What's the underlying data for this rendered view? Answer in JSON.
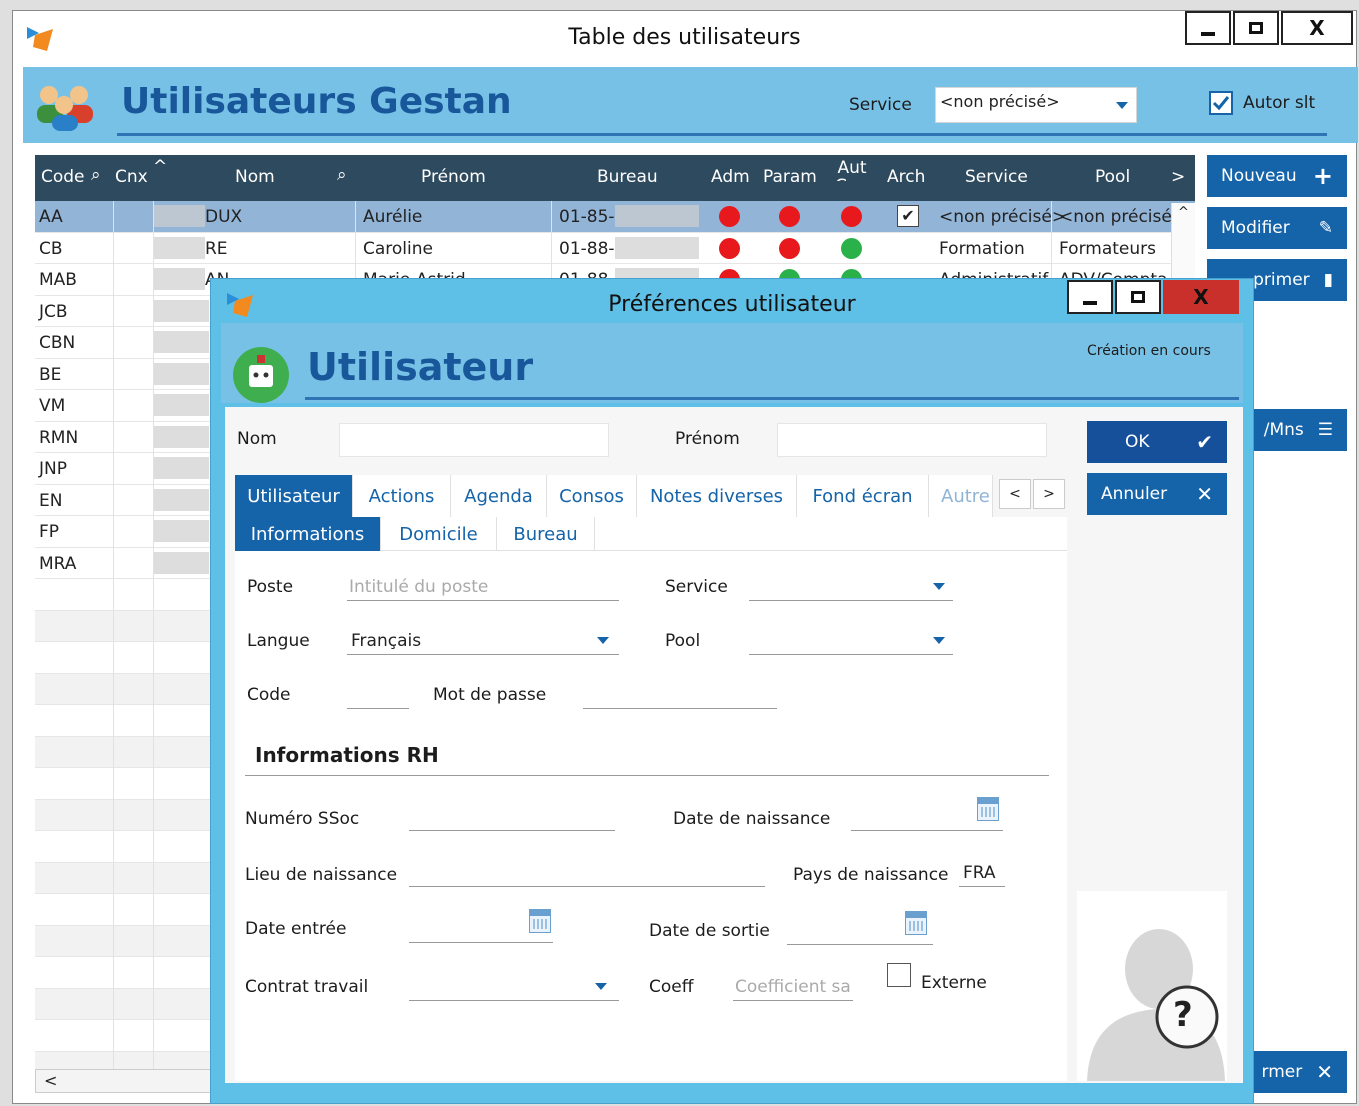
{
  "main_window": {
    "title": "Table des utilisateurs",
    "header_title": "Utilisateurs Gestan",
    "service_label": "Service",
    "service_value": "<non précisé>",
    "autor_label": "Autor slt"
  },
  "columns": [
    "Code",
    "Cnx",
    "Nom",
    "Prénom",
    "Bureau",
    "Adm",
    "Param",
    "Aut Conn",
    "Arch",
    "Service",
    "Pool"
  ],
  "rows": [
    {
      "code": "AA",
      "nom": "DUX",
      "prenom": "Aurélie",
      "bureau": "01-85-",
      "adm": "red",
      "param": "red",
      "aut": "red",
      "arch": true,
      "service": "<non précisé>",
      "pool": "<non précisé>"
    },
    {
      "code": "CB",
      "nom": "RE",
      "prenom": "Caroline",
      "bureau": "01-88-",
      "adm": "red",
      "param": "red",
      "aut": "green",
      "arch": false,
      "service": "Formation",
      "pool": "Formateurs"
    },
    {
      "code": "MAB",
      "nom": "AN",
      "prenom": "Marie-Astrid",
      "bureau": "01-88",
      "adm": "red",
      "param": "green",
      "aut": "green",
      "arch": false,
      "service": "Administratif",
      "pool": "ADV/Compta"
    },
    {
      "code": "JCB"
    },
    {
      "code": "CBN"
    },
    {
      "code": "BE"
    },
    {
      "code": "VM"
    },
    {
      "code": "RMN"
    },
    {
      "code": "JNP"
    },
    {
      "code": "EN"
    },
    {
      "code": "FP"
    },
    {
      "code": "MRA"
    }
  ],
  "side_buttons": {
    "nouveau": "Nouveau",
    "modifier": "Modifier",
    "supprimer": "primer",
    "mns": "/Mns",
    "fermer": "rmer"
  },
  "dialog": {
    "title": "Préférences utilisateur",
    "header_title": "Utilisateur",
    "status": "Création en cours",
    "nom_label": "Nom",
    "prenom_label": "Prénom",
    "ok_label": "OK",
    "annuler_label": "Annuler",
    "tabs": [
      "Utilisateur",
      "Actions",
      "Agenda",
      "Consos",
      "Notes diverses",
      "Fond écran",
      "Autre"
    ],
    "subtabs": [
      "Informations",
      "Domicile",
      "Bureau"
    ],
    "poste_label": "Poste",
    "poste_placeholder": "Intitulé du poste",
    "service_label": "Service",
    "langue_label": "Langue",
    "langue_value": "Français",
    "pool_label": "Pool",
    "code_label": "Code",
    "mdp_label": "Mot de passe",
    "rh_title": "Informations RH",
    "ssoc_label": "Numéro SSoc",
    "naissance_label": "Date de naissance",
    "lieu_label": "Lieu de naissance",
    "pays_label": "Pays de naissance",
    "pays_value": "FRA",
    "entree_label": "Date entrée",
    "sortie_label": "Date de sortie",
    "contrat_label": "Contrat travail",
    "coeff_label": "Coeff",
    "coeff_placeholder": "Coefficient sa",
    "externe_label": "Externe",
    "help_glyph": "?"
  },
  "colors": {
    "accent": "#1563a8",
    "header": "#78c1e6",
    "dialog": "#5ec0e6"
  }
}
